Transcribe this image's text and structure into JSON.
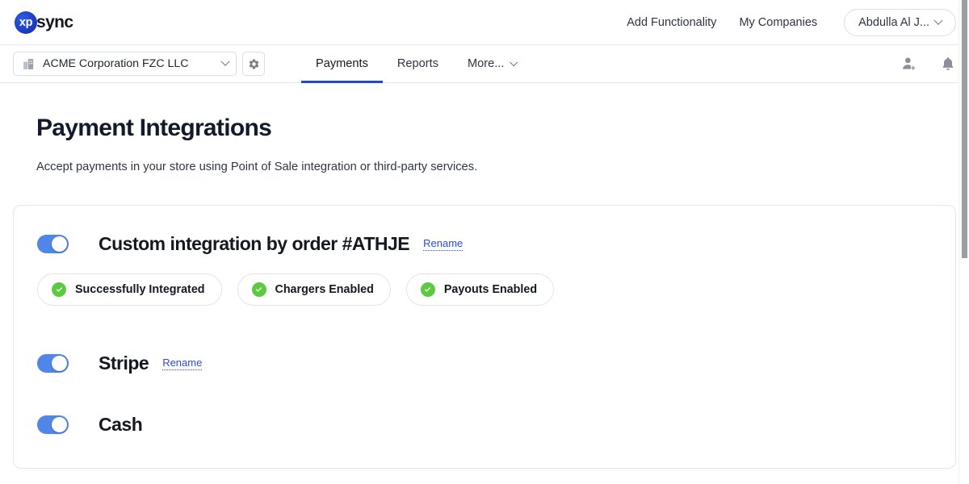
{
  "brand": {
    "mark": "xp",
    "word": "sync"
  },
  "topnav": {
    "links": [
      {
        "label": "Add Functionality",
        "name": "add-functionality"
      },
      {
        "label": "My Companies",
        "name": "my-companies"
      }
    ],
    "user": {
      "label": "Abdulla Al J...",
      "icon": "chevron-down-icon"
    }
  },
  "subbar": {
    "company": {
      "icon": "building-icon",
      "name": "ACME Corporation FZC LLC",
      "chevron": "chevron-down-icon"
    },
    "settings_icon": "gear-icon",
    "tabs": [
      {
        "label": "Payments",
        "active": true
      },
      {
        "label": "Reports",
        "active": false
      },
      {
        "label": "More...",
        "active": false,
        "chevron": true
      }
    ],
    "right_icons": [
      {
        "name": "add-user-icon"
      },
      {
        "name": "notifications-bell-icon"
      }
    ]
  },
  "page": {
    "title": "Payment Integrations",
    "subtitle": "Accept payments in your store using Point of Sale integration or third-party services."
  },
  "integrations": [
    {
      "name": "Custom integration by order #ATHJE",
      "enabled": true,
      "rename_label": "Rename",
      "badges": [
        {
          "label": "Successfully Integrated",
          "icon": "check-circle-icon"
        },
        {
          "label": "Chargers Enabled",
          "icon": "check-circle-icon"
        },
        {
          "label": "Payouts Enabled",
          "icon": "check-circle-icon"
        }
      ]
    },
    {
      "name": "Stripe",
      "enabled": true,
      "rename_label": "Rename",
      "badges": []
    },
    {
      "name": "Cash",
      "enabled": true,
      "rename_label": "",
      "badges": []
    }
  ],
  "colors": {
    "accent_blue": "#1b48e0",
    "toggle_blue": "#4f86e8",
    "success_green": "#5dc943",
    "link_blue": "#2b4ae0",
    "heading": "#131a2b"
  },
  "scrollbar": {
    "name": "vertical-scrollbar"
  }
}
